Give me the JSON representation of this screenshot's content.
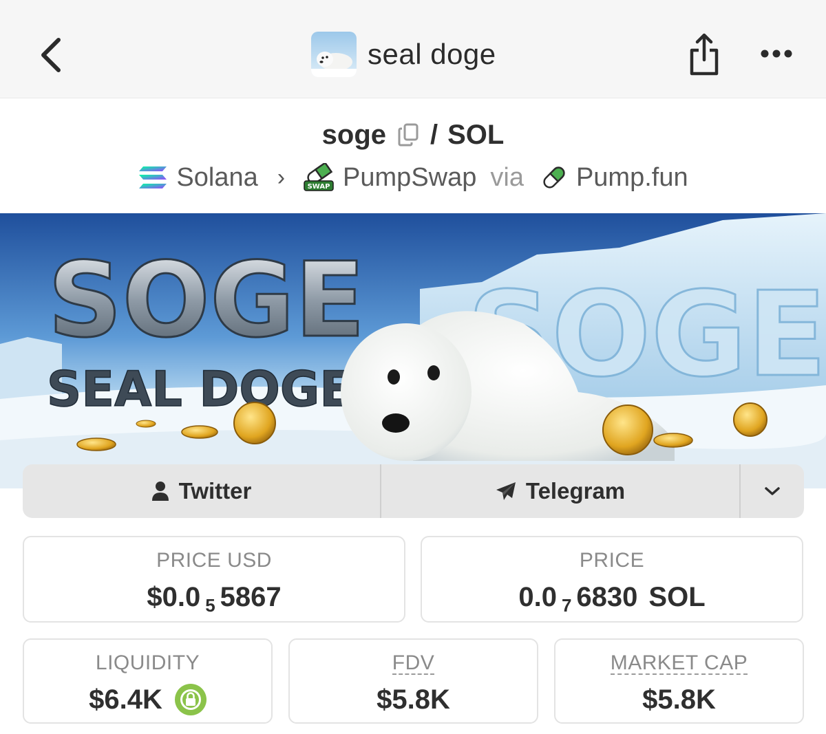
{
  "header": {
    "title": "seal doge",
    "back_icon": "chevron-left-icon",
    "share_icon": "share-icon",
    "more_icon": "more-horizontal-icon"
  },
  "pair": {
    "base": "soge",
    "separator": "/",
    "quote": "SOL"
  },
  "route": {
    "chain": "Solana",
    "dex": "PumpSwap",
    "dex_badge": "SWAP",
    "via_label": "via",
    "launchpad": "Pump.fun"
  },
  "banner": {
    "headline": "SOGE",
    "subhead": "SEAL DOGE",
    "ice_text": "SOGE"
  },
  "socials": {
    "twitter": "Twitter",
    "telegram": "Telegram",
    "expand_icon": "chevron-down-icon"
  },
  "stats": {
    "price_usd": {
      "label": "PRICE USD",
      "prefix": "$0.0",
      "zeros": "5",
      "digits": "5867"
    },
    "price": {
      "label": "PRICE",
      "prefix": "0.0",
      "zeros": "7",
      "digits": "6830",
      "unit": "SOL"
    },
    "liquidity": {
      "label": "LIQUIDITY",
      "value": "$6.4K"
    },
    "fdv": {
      "label": "FDV",
      "value": "$5.8K"
    },
    "market_cap": {
      "label": "MARKET CAP",
      "value": "$5.8K"
    }
  },
  "colors": {
    "lock_badge": "#8bc34a",
    "pump_green": "#3fae5a",
    "solana_gradient": [
      "#00ffa3",
      "#9945ff"
    ]
  }
}
